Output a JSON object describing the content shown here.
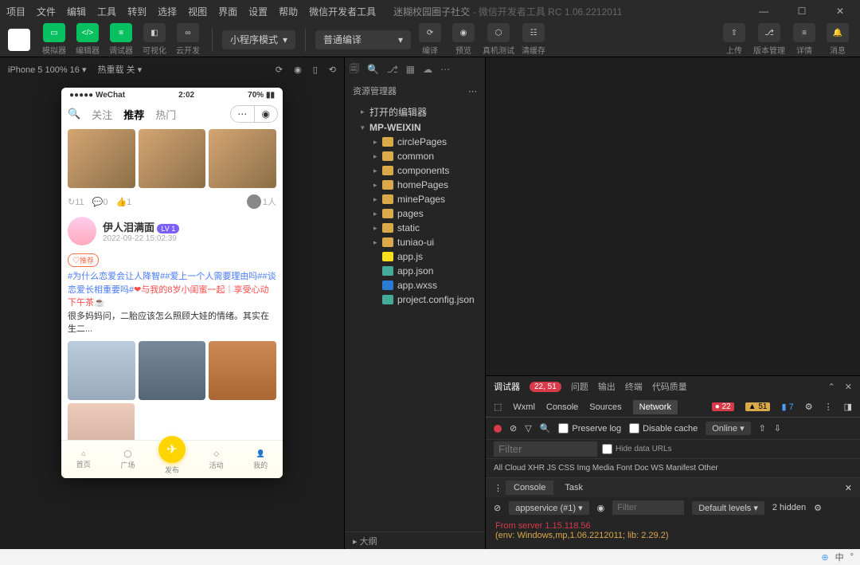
{
  "menus": [
    "项目",
    "文件",
    "编辑",
    "工具",
    "转到",
    "选择",
    "视图",
    "界面",
    "设置",
    "帮助",
    "微信开发者工具"
  ],
  "title_app": "迷糊校园圈子社交",
  "title_sub": " - 微信开发者工具 RC 1.06.2212011",
  "tool_labels": {
    "sim": "模拟器",
    "editor": "编辑器",
    "debug": "调试器",
    "visual": "可视化",
    "cloud": "云开发",
    "mode": "小程序模式",
    "compile_mode": "普通编译",
    "compile": "编译",
    "preview": "预览",
    "real": "真机测试",
    "clear": "清缓存",
    "upload": "上传",
    "version": "版本管理",
    "detail": "详情",
    "msg": "消息"
  },
  "sim_head": {
    "device": "iPhone 5 100% 16",
    "hot": "热重载 关"
  },
  "phone": {
    "carrier": "●●●●● WeChat",
    "time": "2:02",
    "battery": "70%",
    "tabs": {
      "follow": "关注",
      "rec": "推荐",
      "hot": "热门"
    },
    "stats": {
      "retweet": "11",
      "comment": "0",
      "like": "1",
      "people": "1人"
    },
    "post": {
      "name": "伊人泪满面",
      "lv": "LV 1",
      "time": "2022-09-22 15:02:39",
      "rec": "♡推荐",
      "hash1": "#为什么恋爱会让人降智##爱上一个人需要理由吗##谈恋爱长相重要吗#",
      "txt1": "❤与我的8岁小闺蜜一起｜享受心动下午茶☕",
      "txt2": "很多妈妈问，二胎应该怎么照顾大娃的情绪。其实在生二..."
    },
    "bottom": {
      "home": "首页",
      "plaza": "广场",
      "pub": "发布",
      "act": "活动",
      "me": "我的"
    }
  },
  "explorer": {
    "title": "资源管理器",
    "open": "打开的编辑器",
    "root": "MP-WEIXIN",
    "folders": [
      "circlePages",
      "common",
      "components",
      "homePages",
      "minePages",
      "pages",
      "static",
      "tuniao-ui"
    ],
    "files": {
      "appjs": "app.js",
      "appjson": "app.json",
      "appwxss": "app.wxss",
      "proj": "project.config.json"
    },
    "outline": "大纲"
  },
  "dev": {
    "tabs": {
      "debug": "调试器",
      "counts": "22, 51",
      "issues": "问题",
      "output": "输出",
      "terminal": "终端",
      "quality": "代码质量"
    },
    "net_tabs": [
      "Wxml",
      "Console",
      "Sources",
      "Network"
    ],
    "badges": {
      "err": "22",
      "warn": "51",
      "info": "7"
    },
    "netbar": {
      "preserve": "Preserve log",
      "disable": "Disable cache",
      "online": "Online"
    },
    "filter": {
      "ph": "Filter",
      "hide": "Hide data URLs",
      "types": "All  Cloud  XHR  JS  CSS  Img  Media  Font  Doc  WS  Manifest  Other"
    },
    "console_tabs": {
      "console": "Console",
      "task": "Task"
    },
    "console_bar": {
      "ctx": "appservice (#1)",
      "filter_ph": "Filter",
      "levels": "Default levels",
      "hidden": "2 hidden"
    },
    "console": {
      "l1": "From server 1.15.118.56",
      "l2": "(env: Windows,mp,1.06.2212011; lib: 2.29.2)"
    }
  },
  "footer": {
    "ime": "中"
  }
}
